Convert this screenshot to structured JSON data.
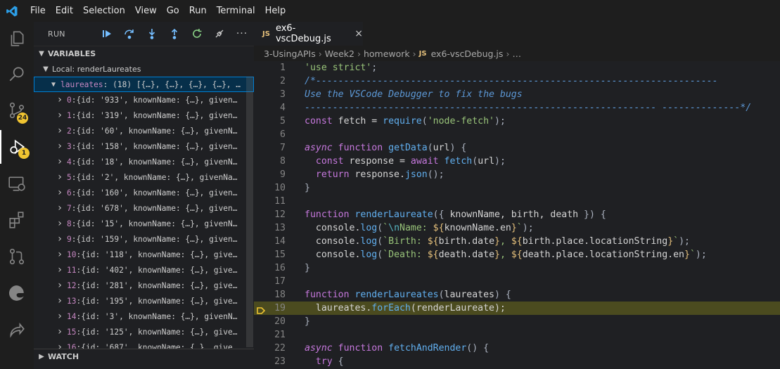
{
  "menu": [
    "File",
    "Edit",
    "Selection",
    "View",
    "Go",
    "Run",
    "Terminal",
    "Help"
  ],
  "activity_bar": {
    "source_control_badge": "24",
    "run_debug_badge": "1"
  },
  "sidebar": {
    "title": "RUN",
    "variables_header": "VARIABLES",
    "scope_label": "Local: renderLaureates",
    "laureates": {
      "key": "laureates",
      "colon": ":",
      "length": "(18)",
      "preview": "[{…}, {…}, {…}, {…}, …"
    },
    "items": [
      {
        "key": "0",
        "value": "{id: '933', knownName: {…}, given…"
      },
      {
        "key": "1",
        "value": "{id: '319', knownName: {…}, given…"
      },
      {
        "key": "2",
        "value": "{id: '60', knownName: {…}, givenN…"
      },
      {
        "key": "3",
        "value": "{id: '158', knownName: {…}, given…"
      },
      {
        "key": "4",
        "value": "{id: '18', knownName: {…}, givenN…"
      },
      {
        "key": "5",
        "value": "{id: '2', knownName: {…}, givenNa…"
      },
      {
        "key": "6",
        "value": "{id: '160', knownName: {…}, given…"
      },
      {
        "key": "7",
        "value": "{id: '678', knownName: {…}, given…"
      },
      {
        "key": "8",
        "value": "{id: '15', knownName: {…}, givenN…"
      },
      {
        "key": "9",
        "value": "{id: '159', knownName: {…}, given…"
      },
      {
        "key": "10",
        "value": "{id: '118', knownName: {…}, give…"
      },
      {
        "key": "11",
        "value": "{id: '402', knownName: {…}, give…"
      },
      {
        "key": "12",
        "value": "{id: '281', knownName: {…}, give…"
      },
      {
        "key": "13",
        "value": "{id: '195', knownName: {…}, give…"
      },
      {
        "key": "14",
        "value": "{id: '3', knownName: {…}, givenN…"
      },
      {
        "key": "15",
        "value": "{id: '125', knownName: {…}, give…"
      },
      {
        "key": "16",
        "value": "{id: '687', knownName: {…}, give…"
      }
    ],
    "watch_header": "WATCH"
  },
  "editor": {
    "tab_label": "ex6-vscDebug.js",
    "tab_badge": "JS",
    "tab_close": "×",
    "breadcrumb": {
      "parts": [
        "3-UsingAPIs",
        "Week2",
        "homework"
      ],
      "file": "ex6-vscDebug.js",
      "tail": "…"
    },
    "lines": [
      {
        "n": "1",
        "tokens": [
          [
            "str",
            "'use strict'"
          ],
          [
            "punct",
            ";"
          ]
        ]
      },
      {
        "n": "2",
        "tokens": [
          [
            "cmt",
            "/*------------------------------------------------------------------------"
          ]
        ]
      },
      {
        "n": "3",
        "tokens": [
          [
            "cmt",
            "Use the VSCode Debugger to fix the bugs"
          ]
        ]
      },
      {
        "n": "4",
        "tokens": [
          [
            "cmt",
            "--------------------------------------------------------------- --------------*/"
          ]
        ]
      },
      {
        "n": "5",
        "tokens": [
          [
            "kw",
            "const"
          ],
          [
            "plain",
            " fetch = "
          ],
          [
            "fn",
            "require"
          ],
          [
            "punct",
            "("
          ],
          [
            "str",
            "'node-fetch'"
          ],
          [
            "punct",
            ");"
          ]
        ]
      },
      {
        "n": "6",
        "tokens": []
      },
      {
        "n": "7",
        "tokens": [
          [
            "kwi",
            "async"
          ],
          [
            "plain",
            " "
          ],
          [
            "kw",
            "function"
          ],
          [
            "plain",
            " "
          ],
          [
            "fn",
            "getData"
          ],
          [
            "punct",
            "("
          ],
          [
            "plain",
            "url"
          ],
          [
            "punct",
            ") {"
          ]
        ]
      },
      {
        "n": "8",
        "tokens": [
          [
            "plain",
            "  "
          ],
          [
            "kw",
            "const"
          ],
          [
            "plain",
            " response = "
          ],
          [
            "kw",
            "await"
          ],
          [
            "plain",
            " "
          ],
          [
            "fn",
            "fetch"
          ],
          [
            "punct",
            "("
          ],
          [
            "plain",
            "url"
          ],
          [
            "punct",
            ");"
          ]
        ]
      },
      {
        "n": "9",
        "tokens": [
          [
            "plain",
            "  "
          ],
          [
            "kw",
            "return"
          ],
          [
            "plain",
            " response."
          ],
          [
            "fn",
            "json"
          ],
          [
            "punct",
            "();"
          ]
        ]
      },
      {
        "n": "10",
        "tokens": [
          [
            "punct",
            "}"
          ]
        ]
      },
      {
        "n": "11",
        "tokens": []
      },
      {
        "n": "12",
        "tokens": [
          [
            "kw",
            "function"
          ],
          [
            "plain",
            " "
          ],
          [
            "fn",
            "renderLaureate"
          ],
          [
            "punct",
            "({ "
          ],
          [
            "plain",
            "knownName, birth, death"
          ],
          [
            "punct",
            " }) {"
          ]
        ]
      },
      {
        "n": "13",
        "tokens": [
          [
            "plain",
            "  console."
          ],
          [
            "fn",
            "log"
          ],
          [
            "punct",
            "("
          ],
          [
            "str",
            "`"
          ],
          [
            "esc",
            "\\n"
          ],
          [
            "str",
            "Name: "
          ],
          [
            "tpl",
            "${"
          ],
          [
            "plain",
            "knownName.en"
          ],
          [
            "tpl",
            "}"
          ],
          [
            "str",
            "`"
          ],
          [
            "punct",
            ");"
          ]
        ]
      },
      {
        "n": "14",
        "tokens": [
          [
            "plain",
            "  console."
          ],
          [
            "fn",
            "log"
          ],
          [
            "punct",
            "("
          ],
          [
            "str",
            "`Birth: "
          ],
          [
            "tpl",
            "${"
          ],
          [
            "plain",
            "birth.date"
          ],
          [
            "tpl",
            "}"
          ],
          [
            "str",
            ", "
          ],
          [
            "tpl",
            "${"
          ],
          [
            "plain",
            "birth.place.locationString"
          ],
          [
            "tpl",
            "}"
          ],
          [
            "str",
            "`"
          ],
          [
            "punct",
            ");"
          ]
        ]
      },
      {
        "n": "15",
        "tokens": [
          [
            "plain",
            "  console."
          ],
          [
            "fn",
            "log"
          ],
          [
            "punct",
            "("
          ],
          [
            "str",
            "`Death: "
          ],
          [
            "tpl",
            "${"
          ],
          [
            "plain",
            "death.date"
          ],
          [
            "tpl",
            "}"
          ],
          [
            "str",
            ", "
          ],
          [
            "tpl",
            "${"
          ],
          [
            "plain",
            "death.place.locationString.en"
          ],
          [
            "tpl",
            "}"
          ],
          [
            "str",
            "`"
          ],
          [
            "punct",
            ");"
          ]
        ]
      },
      {
        "n": "16",
        "tokens": [
          [
            "punct",
            "}"
          ]
        ]
      },
      {
        "n": "17",
        "tokens": []
      },
      {
        "n": "18",
        "tokens": [
          [
            "kw",
            "function"
          ],
          [
            "plain",
            " "
          ],
          [
            "fn",
            "renderLaureates"
          ],
          [
            "punct",
            "("
          ],
          [
            "plain",
            "laureates"
          ],
          [
            "punct",
            ") {"
          ]
        ]
      },
      {
        "n": "19",
        "tokens": [
          [
            "plain",
            "  laureates."
          ],
          [
            "fn",
            "forEach"
          ],
          [
            "punct",
            "("
          ],
          [
            "plain",
            "renderLaureate"
          ],
          [
            "punct",
            ");"
          ]
        ],
        "highlight": true
      },
      {
        "n": "20",
        "tokens": [
          [
            "punct",
            "}"
          ]
        ]
      },
      {
        "n": "21",
        "tokens": []
      },
      {
        "n": "22",
        "tokens": [
          [
            "kwi",
            "async"
          ],
          [
            "plain",
            " "
          ],
          [
            "kw",
            "function"
          ],
          [
            "plain",
            " "
          ],
          [
            "fn",
            "fetchAndRender"
          ],
          [
            "punct",
            "() {"
          ]
        ]
      },
      {
        "n": "23",
        "tokens": [
          [
            "plain",
            "  "
          ],
          [
            "kw",
            "try"
          ],
          [
            "plain",
            " "
          ],
          [
            "punct",
            "{"
          ]
        ]
      }
    ]
  },
  "colors": {
    "accent": "#007fd4",
    "badge": "#f0c431",
    "highlight_line": "#4b4b1f"
  }
}
